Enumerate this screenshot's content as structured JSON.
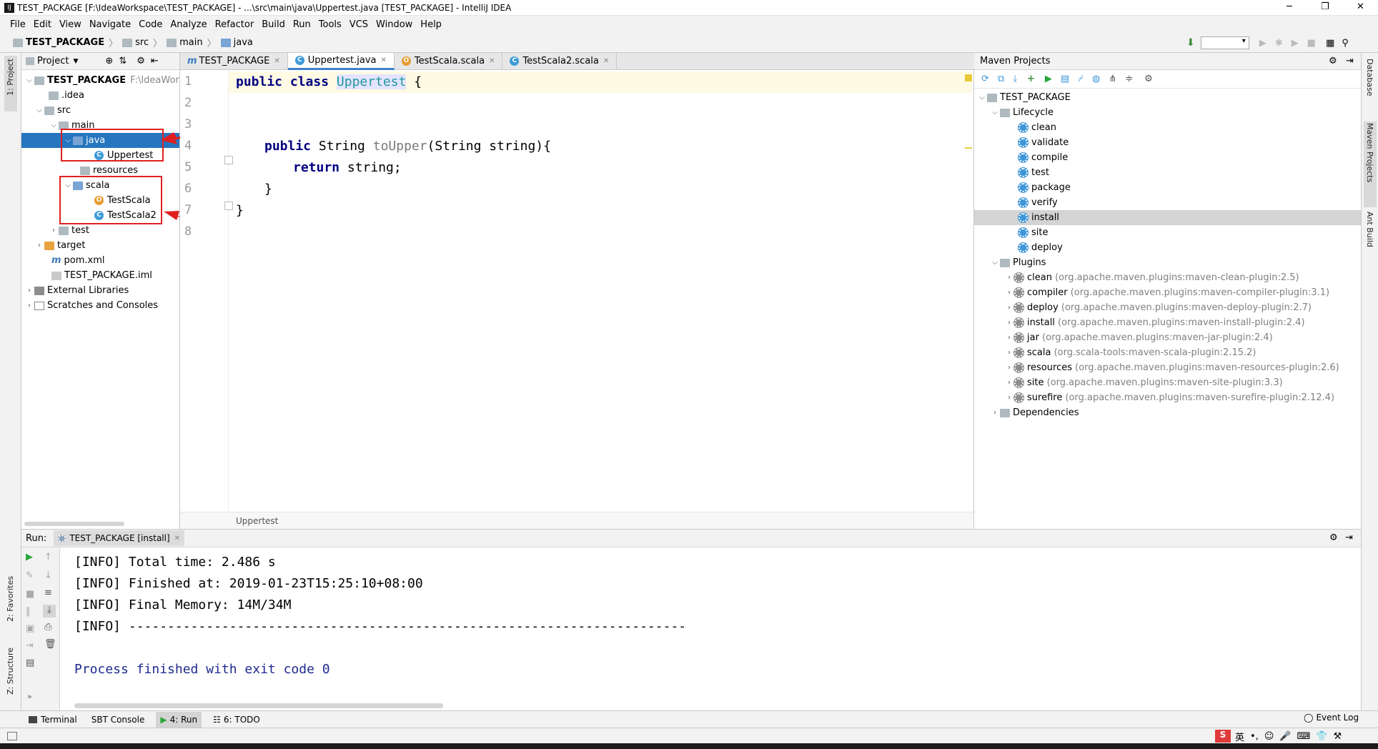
{
  "window": {
    "title": "TEST_PACKAGE [F:\\IdeaWorkspace\\TEST_PACKAGE] - ...\\src\\main\\java\\Uppertest.java [TEST_PACKAGE] - IntelliJ IDEA",
    "minimize": "─",
    "maximize": "❐",
    "close": "✕"
  },
  "menu": [
    "File",
    "Edit",
    "View",
    "Navigate",
    "Code",
    "Analyze",
    "Refactor",
    "Build",
    "Run",
    "Tools",
    "VCS",
    "Window",
    "Help"
  ],
  "breadcrumb": [
    "TEST_PACKAGE",
    "src",
    "main",
    "java"
  ],
  "project": {
    "title": "Project",
    "root": "TEST_PACKAGE",
    "root_path": "F:\\IdeaWorkspace",
    "items": [
      ".idea",
      "src",
      "main",
      "java",
      "Uppertest",
      "resources",
      "scala",
      "TestScala",
      "TestScala2",
      "test",
      "target",
      "pom.xml",
      "TEST_PACKAGE.iml",
      "External Libraries",
      "Scratches and Consoles"
    ]
  },
  "tabs": [
    "TEST_PACKAGE",
    "Uppertest.java",
    "TestScala.scala",
    "TestScala2.scala"
  ],
  "code": {
    "line_numbers": [
      "1",
      "2",
      "3",
      "4",
      "5",
      "6",
      "7",
      "8"
    ],
    "l1_kw": "public class",
    "l1_name": "Uppertest",
    "l1_brace": " {",
    "l4_kw": "public",
    "l4_rest": " String ",
    "l4_method": "toUpper",
    "l4_sig": "(String string){",
    "l5_kw": "return",
    "l5_rest": " string;",
    "l6": "}",
    "l7": "}",
    "footer": "Uppertest"
  },
  "maven": {
    "title": "Maven Projects",
    "root": "TEST_PACKAGE",
    "lifecycle_label": "Lifecycle",
    "lifecycle": [
      "clean",
      "validate",
      "compile",
      "test",
      "package",
      "verify",
      "install",
      "site",
      "deploy"
    ],
    "plugins_label": "Plugins",
    "plugins": [
      {
        "name": "clean",
        "coord": "(org.apache.maven.plugins:maven-clean-plugin:2.5)"
      },
      {
        "name": "compiler",
        "coord": "(org.apache.maven.plugins:maven-compiler-plugin:3.1)"
      },
      {
        "name": "deploy",
        "coord": "(org.apache.maven.plugins:maven-deploy-plugin:2.7)"
      },
      {
        "name": "install",
        "coord": "(org.apache.maven.plugins:maven-install-plugin:2.4)"
      },
      {
        "name": "jar",
        "coord": "(org.apache.maven.plugins:maven-jar-plugin:2.4)"
      },
      {
        "name": "scala",
        "coord": "(org.scala-tools:maven-scala-plugin:2.15.2)"
      },
      {
        "name": "resources",
        "coord": "(org.apache.maven.plugins:maven-resources-plugin:2.6)"
      },
      {
        "name": "site",
        "coord": "(org.apache.maven.plugins:maven-site-plugin:3.3)"
      },
      {
        "name": "surefire",
        "coord": "(org.apache.maven.plugins:maven-surefire-plugin:2.12.4)"
      }
    ],
    "dependencies_label": "Dependencies"
  },
  "run": {
    "label": "Run:",
    "tab": "TEST_PACKAGE [install]",
    "lines": [
      "[INFO] Total time: 2.486 s",
      "[INFO] Finished at: 2019-01-23T15:25:10+08:00",
      "[INFO] Final Memory: 14M/34M",
      "[INFO] ------------------------------------------------------------------------"
    ],
    "exit": "Process finished with exit code 0"
  },
  "bottom_tools": [
    "Terminal",
    "SBT Console",
    "4: Run",
    "6: TODO"
  ],
  "event_log": "Event Log",
  "side_labels": {
    "project": "1: Project",
    "favorites": "2: Favorites",
    "structure": "Z: Structure",
    "database": "Database",
    "maven": "Maven Projects",
    "ant": "Ant Build"
  },
  "ime": "英",
  "colors": {
    "accent": "#2675bf",
    "annotation": "#e02020",
    "keyword": "#000080",
    "console_exit": "#1f2a8f"
  }
}
